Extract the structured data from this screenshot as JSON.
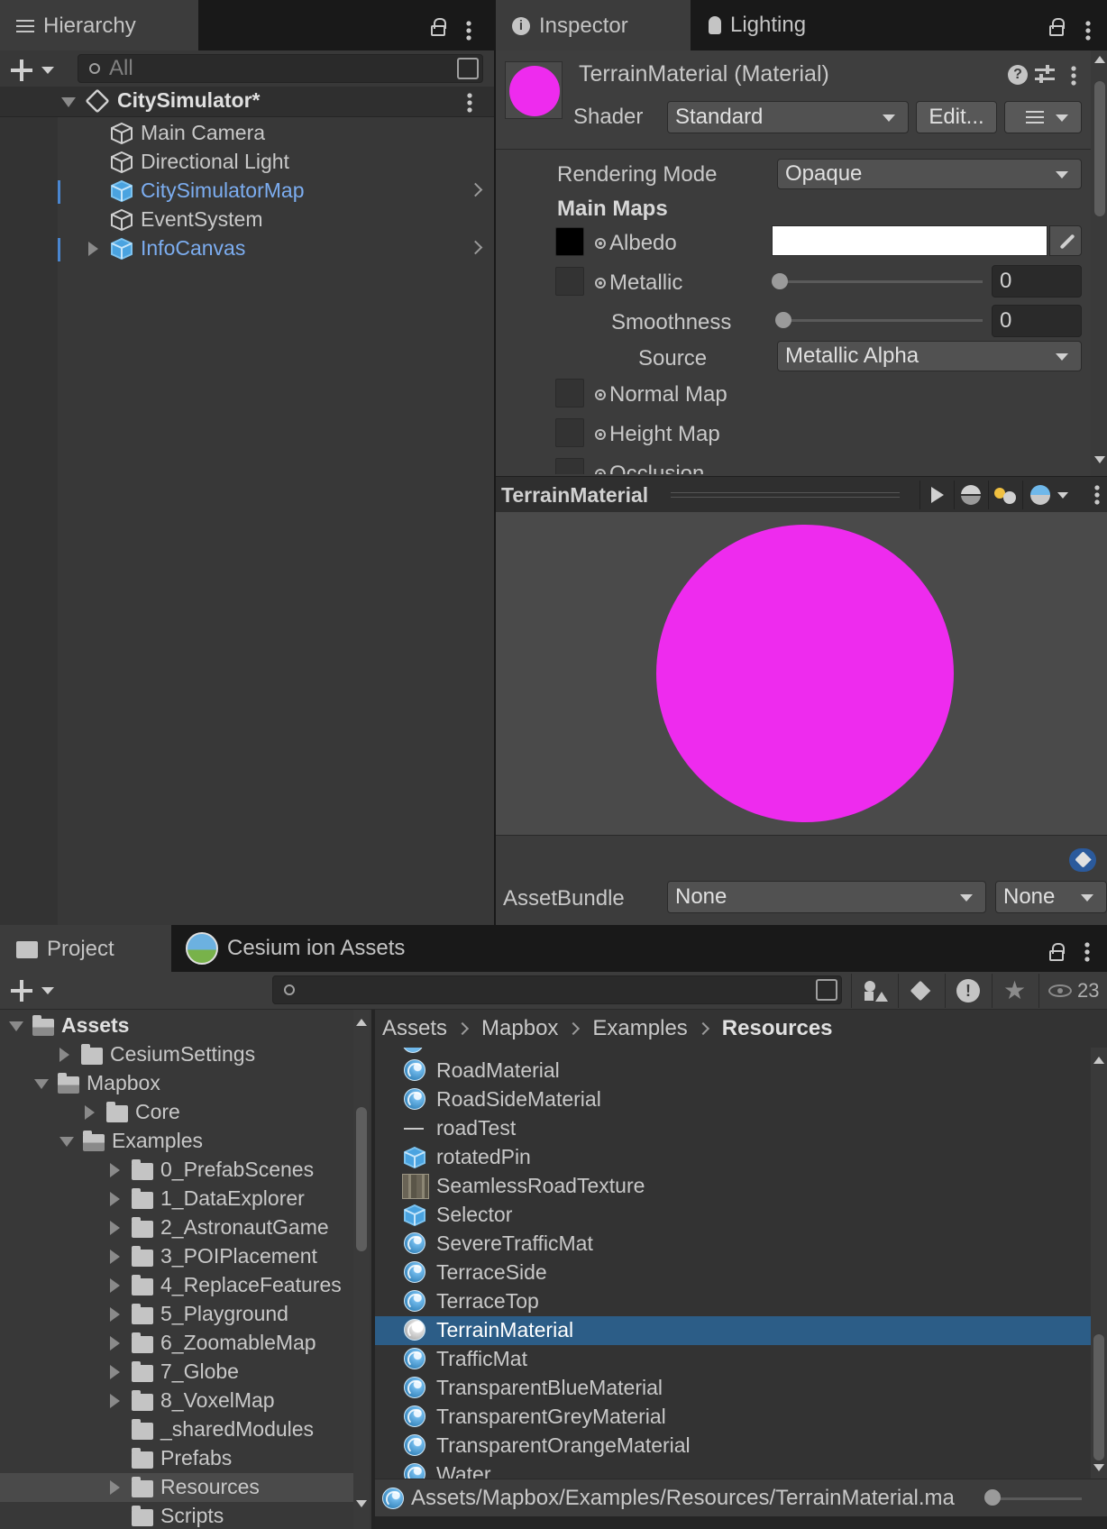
{
  "colors": {
    "material_preview": "#ee2bee",
    "selection": "#2c5d87",
    "prefab_text": "#7cadf0"
  },
  "hierarchy": {
    "tab_label": "Hierarchy",
    "search_placeholder": "All",
    "scene_name": "CitySimulator*",
    "items": [
      {
        "label": "Main Camera",
        "prefab": false,
        "expandable": false
      },
      {
        "label": "Directional Light",
        "prefab": false,
        "expandable": false
      },
      {
        "label": "CitySimulatorMap",
        "prefab": true,
        "expandable": false
      },
      {
        "label": "EventSystem",
        "prefab": false,
        "expandable": false
      },
      {
        "label": "InfoCanvas",
        "prefab": true,
        "expandable": true
      }
    ]
  },
  "inspector": {
    "tabs": [
      "Inspector",
      "Lighting"
    ],
    "material_title": "TerrainMaterial (Material)",
    "shader_label": "Shader",
    "shader_value": "Standard",
    "edit_button": "Edit...",
    "rendering_mode_label": "Rendering Mode",
    "rendering_mode_value": "Opaque",
    "main_maps_label": "Main Maps",
    "albedo_label": "Albedo",
    "metallic_label": "Metallic",
    "metallic_value": "0",
    "smoothness_label": "Smoothness",
    "smoothness_value": "0",
    "source_label": "Source",
    "source_value": "Metallic Alpha",
    "normal_map_label": "Normal Map",
    "height_map_label": "Height Map",
    "occlusion_label": "Occlusion",
    "preview_title": "TerrainMaterial",
    "assetbundle_label": "AssetBundle",
    "assetbundle_name": "None",
    "assetbundle_variant": "None"
  },
  "project": {
    "tabs": [
      "Project",
      "Cesium ion Assets"
    ],
    "hidden_count": "23",
    "breadcrumb": [
      "Assets",
      "Mapbox",
      "Examples",
      "Resources"
    ],
    "tree": [
      {
        "label": "Assets",
        "depth": 0,
        "arrow": "down",
        "bold": true,
        "open": true
      },
      {
        "label": "CesiumSettings",
        "depth": 1,
        "arrow": "right"
      },
      {
        "label": "Mapbox",
        "depth": 1,
        "arrow": "down",
        "open": true
      },
      {
        "label": "Core",
        "depth": 2,
        "arrow": "right"
      },
      {
        "label": "Examples",
        "depth": 2,
        "arrow": "down",
        "open": true
      },
      {
        "label": "0_PrefabScenes",
        "depth": 3,
        "arrow": "right"
      },
      {
        "label": "1_DataExplorer",
        "depth": 3,
        "arrow": "right"
      },
      {
        "label": "2_AstronautGame",
        "depth": 3,
        "arrow": "right"
      },
      {
        "label": "3_POIPlacement",
        "depth": 3,
        "arrow": "right"
      },
      {
        "label": "4_ReplaceFeatures",
        "depth": 3,
        "arrow": "right"
      },
      {
        "label": "5_Playground",
        "depth": 3,
        "arrow": "right"
      },
      {
        "label": "6_ZoomableMap",
        "depth": 3,
        "arrow": "right"
      },
      {
        "label": "7_Globe",
        "depth": 3,
        "arrow": "right"
      },
      {
        "label": "8_VoxelMap",
        "depth": 3,
        "arrow": "right"
      },
      {
        "label": "_sharedModules",
        "depth": 3,
        "arrow": "none"
      },
      {
        "label": "Prefabs",
        "depth": 3,
        "arrow": "none"
      },
      {
        "label": "Resources",
        "depth": 3,
        "arrow": "right",
        "selected": true
      },
      {
        "label": "Scripts",
        "depth": 3,
        "arrow": "none"
      }
    ],
    "files": [
      {
        "label": "RoadMaterial",
        "icon": "material-icon"
      },
      {
        "label": "RoadSideMaterial",
        "icon": "material-icon"
      },
      {
        "label": "roadTest",
        "icon": "mesh-icon"
      },
      {
        "label": "rotatedPin",
        "icon": "prefab-icon"
      },
      {
        "label": "SeamlessRoadTexture",
        "icon": "texture-icon"
      },
      {
        "label": "Selector",
        "icon": "prefab-icon"
      },
      {
        "label": "SevereTrafficMat",
        "icon": "material-icon"
      },
      {
        "label": "TerraceSide",
        "icon": "material-icon"
      },
      {
        "label": "TerraceTop",
        "icon": "material-icon"
      },
      {
        "label": "TerrainMaterial",
        "icon": "material-icon",
        "selected": true
      },
      {
        "label": "TrafficMat",
        "icon": "material-icon"
      },
      {
        "label": "TransparentBlueMaterial",
        "icon": "material-icon"
      },
      {
        "label": "TransparentGreyMaterial",
        "icon": "material-icon"
      },
      {
        "label": "TransparentOrangeMaterial",
        "icon": "material-icon"
      },
      {
        "label": "Water",
        "icon": "material-icon"
      }
    ],
    "status_path": "Assets/Mapbox/Examples/Resources/TerrainMaterial.ma"
  }
}
